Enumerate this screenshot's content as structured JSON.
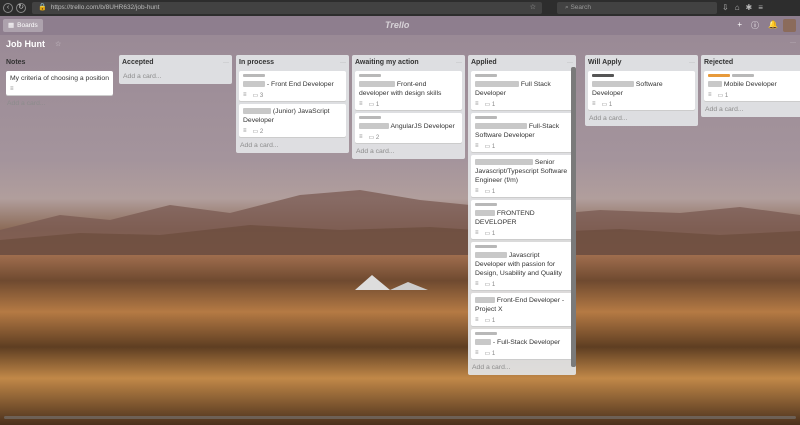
{
  "browser": {
    "url": "https://trello.com/b/8UHR632/job-hunt",
    "search_placeholder": "Search"
  },
  "header": {
    "boards_label": "Boards",
    "logo": "Trello"
  },
  "board": {
    "title": "Job Hunt",
    "add_card_label": "Add a card...",
    "lists": [
      {
        "title": "Notes",
        "cards": [
          {
            "text": "My criteria of choosing a position",
            "labels": [],
            "comments": "",
            "blur_width": 0
          }
        ]
      },
      {
        "title": "Accepted",
        "cards": []
      },
      {
        "title": "In process",
        "cards": [
          {
            "text": " - Front End Developer",
            "labels": [
              "gray"
            ],
            "comments": "3",
            "blur_width": 22
          },
          {
            "text": " (Junior) JavaScript Developer",
            "labels": [],
            "comments": "2",
            "blur_width": 28
          }
        ]
      },
      {
        "title": "Awaiting my action",
        "cards": [
          {
            "text": " Front-end developer with design skills",
            "labels": [
              "gray"
            ],
            "comments": "1",
            "blur_width": 36
          },
          {
            "text": " AngularJS Developer",
            "labels": [
              "gray"
            ],
            "comments": "2",
            "blur_width": 30
          }
        ]
      },
      {
        "title": "Applied",
        "cards": [
          {
            "text": " Full Stack Developer",
            "labels": [
              "gray"
            ],
            "comments": "1",
            "blur_width": 44
          },
          {
            "text": " Full-Stack Software Developer",
            "labels": [
              "gray"
            ],
            "comments": "1",
            "blur_width": 52
          },
          {
            "text": " Senior Javascript/Typescript Software Engineer (f/m)",
            "labels": [],
            "comments": "1",
            "blur_width": 58
          },
          {
            "text": " FRONTEND DEVELOPER",
            "labels": [
              "gray"
            ],
            "comments": "1",
            "blur_width": 20
          },
          {
            "text": " Javascript Developer with passion for Design, Usability and Quality",
            "labels": [
              "gray"
            ],
            "comments": "1",
            "blur_width": 32
          },
          {
            "text": " Front-End Developer - Project X",
            "labels": [],
            "comments": "1",
            "blur_width": 20
          },
          {
            "text": " - Full-Stack Developer",
            "labels": [
              "gray"
            ],
            "comments": "1",
            "blur_width": 16
          }
        ]
      },
      {
        "title": "Will Apply",
        "cards": [
          {
            "text": " Software Developer",
            "labels": [
              "dark"
            ],
            "comments": "1",
            "blur_width": 42
          }
        ]
      },
      {
        "title": "Rejected",
        "cards": [
          {
            "text": " Mobile Developer",
            "labels": [
              "orange",
              "gray"
            ],
            "comments": "1",
            "blur_width": 14
          }
        ]
      }
    ]
  }
}
